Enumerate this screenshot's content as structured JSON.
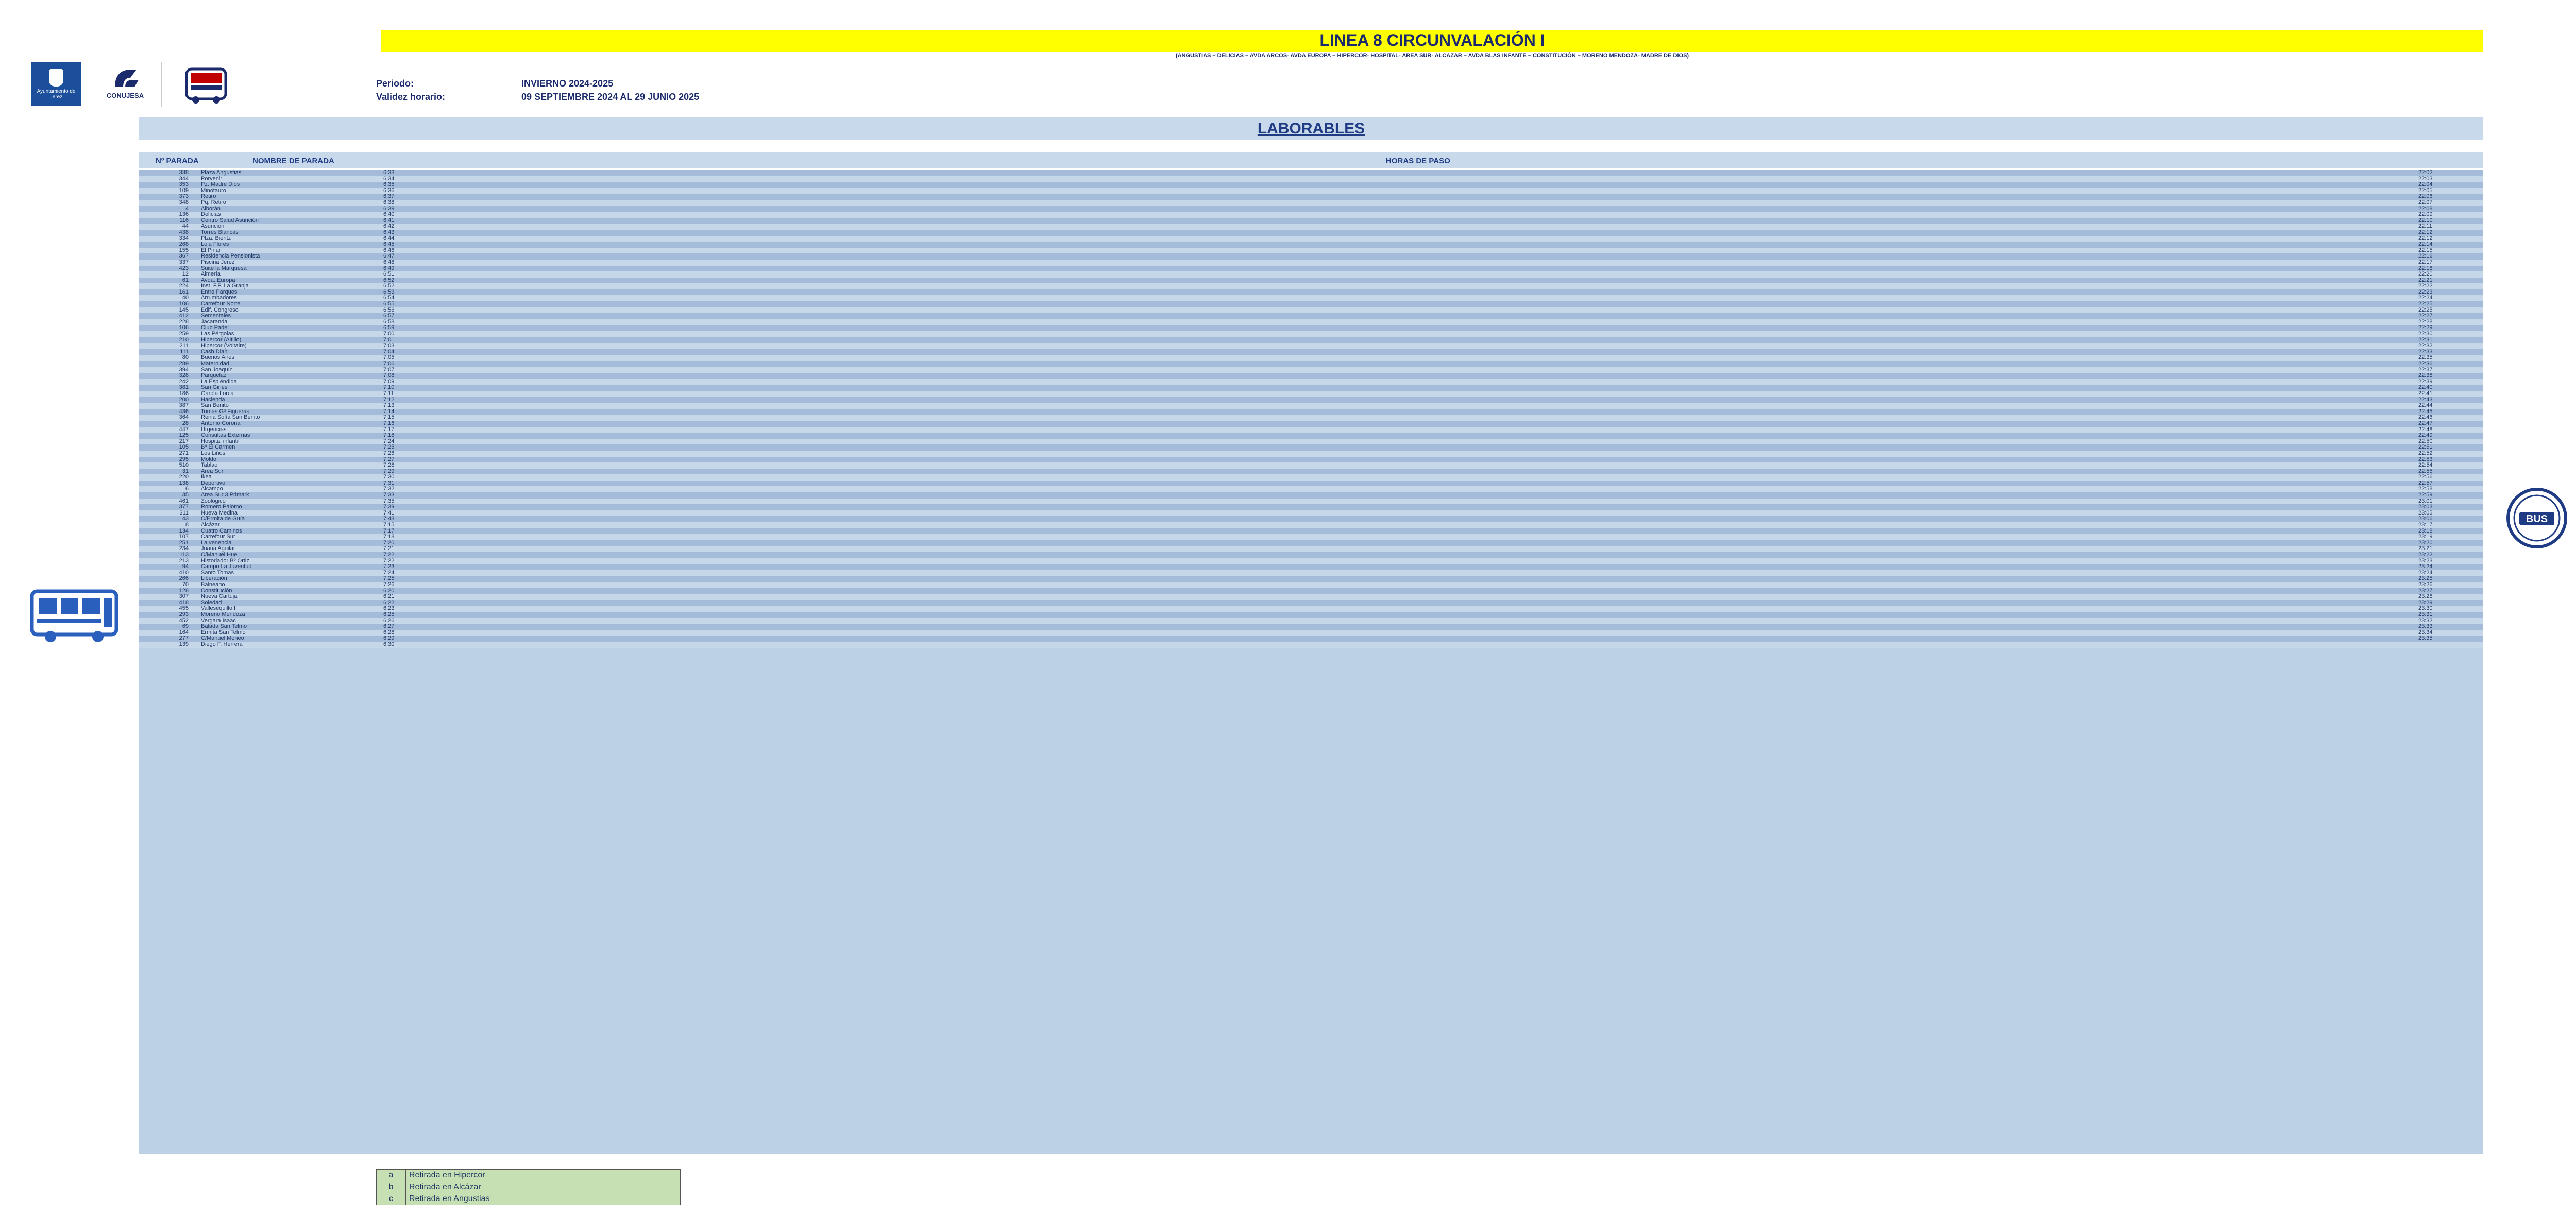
{
  "header": {
    "title": "LINEA 8 CIRCUNVALACIÓN I",
    "subtitle": "(ANGUSTIAS – DELICIAS – AVDA ARCOS- AVDA EUROPA – HIPERCOR- HOSPITAL- AREA SUR- ALCAZAR – AVDA BLAS INFANTE – CONSTITUCIÓN – MORENO MENDOZA- MADRE DE DIOS)",
    "periodo_label": "Periodo:",
    "periodo_value": "INVIERNO 2024-2025",
    "validez_label": "Validez horario:",
    "validez_value": "09 SEPTIEMBRE 2024 AL 29 JUNIO 2025",
    "logo_ayto": "Ayuntamiento de Jerez",
    "logo_conujesa": "CONUJESA"
  },
  "section_title": "LABORABLES",
  "column_headers": {
    "parada": "Nº PARADA",
    "nombre": "NOMBRE DE PARADA",
    "horas": "HORAS DE PASO"
  },
  "stops": [
    {
      "num": "338",
      "name": "Plaza Angustias",
      "first": "6:33",
      "last": "22:02"
    },
    {
      "num": "344",
      "name": "Porvenir",
      "first": "6:34",
      "last": "22:03"
    },
    {
      "num": "353",
      "name": "Pz. Madre Dios",
      "first": "6:35",
      "last": "22:04"
    },
    {
      "num": "109",
      "name": "Minotauro",
      "first": "6:36",
      "last": "22:05"
    },
    {
      "num": "373",
      "name": "Retiro",
      "first": "6:37",
      "last": "22:06"
    },
    {
      "num": "348",
      "name": "Pq. Retiro",
      "first": "6:38",
      "last": "22:07"
    },
    {
      "num": "4",
      "name": "Alborán",
      "first": "6:39",
      "last": "22:08"
    },
    {
      "num": "136",
      "name": "Delicias",
      "first": "6:40",
      "last": "22:09"
    },
    {
      "num": "116",
      "name": "Centro Salud Asunción",
      "first": "6:41",
      "last": "22:10"
    },
    {
      "num": "44",
      "name": "Asunción",
      "first": "6:42",
      "last": "22:11"
    },
    {
      "num": "438",
      "name": "Torres Blancas",
      "first": "6:43",
      "last": "22:12"
    },
    {
      "num": "334",
      "name": "Plza. Bientz",
      "first": "6:44",
      "last": "22:12"
    },
    {
      "num": "268",
      "name": "Lola Flores",
      "first": "6:45",
      "last": "22:14"
    },
    {
      "num": "155",
      "name": "El Pinar",
      "first": "6:46",
      "last": "22:15"
    },
    {
      "num": "367",
      "name": "Residencia Pensionista",
      "first": "6:47",
      "last": "22:16"
    },
    {
      "num": "337",
      "name": "Piscina Jerez",
      "first": "6:48",
      "last": "22:17"
    },
    {
      "num": "423",
      "name": "Suite la Marquesa",
      "first": "6:49",
      "last": "22:18"
    },
    {
      "num": "12",
      "name": "Almería",
      "first": "6:51",
      "last": "22:20"
    },
    {
      "num": "61",
      "name": "Avda. Europa",
      "first": "6:52",
      "last": "22:21"
    },
    {
      "num": "224",
      "name": "Inst. F.P. La Granja",
      "first": "6:52",
      "last": "22:22"
    },
    {
      "num": "161",
      "name": "Entre Parques",
      "first": "6:53",
      "last": "22:23"
    },
    {
      "num": "40",
      "name": "Arrumbadores",
      "first": "6:54",
      "last": "22:24"
    },
    {
      "num": "106",
      "name": "Carrefour Norte",
      "first": "6:55",
      "last": "22:25"
    },
    {
      "num": "145",
      "name": "Edif. Congreso",
      "first": "6:56",
      "last": "22:25"
    },
    {
      "num": "412",
      "name": "Sementales",
      "first": "6:57",
      "last": "22:27"
    },
    {
      "num": "228",
      "name": "Jacaranda",
      "first": "6:58",
      "last": "22:28"
    },
    {
      "num": "106",
      "name": "Club Padel",
      "first": "6:59",
      "last": "22:29"
    },
    {
      "num": "259",
      "name": "Las Pérgolas",
      "first": "7:00",
      "last": "22:30"
    },
    {
      "num": "210",
      "name": "Hipercor (Altillo)",
      "first": "7:01",
      "last": "22:31"
    },
    {
      "num": "211",
      "name": "Hipercor (Voltaire)",
      "first": "7:03",
      "last": "22:32"
    },
    {
      "num": "111",
      "name": "Cash Dian",
      "first": "7:04",
      "last": "22:33"
    },
    {
      "num": "80",
      "name": "Buenos Aires",
      "first": "7:05",
      "last": "22:35"
    },
    {
      "num": "289",
      "name": "Maternidad",
      "first": "7:06",
      "last": "22:36"
    },
    {
      "num": "394",
      "name": "San Joaquín",
      "first": "7:07",
      "last": "22:37"
    },
    {
      "num": "328",
      "name": "Parquelaz",
      "first": "7:08",
      "last": "22:38"
    },
    {
      "num": "242",
      "name": "La Espléndida",
      "first": "7:09",
      "last": "22:39"
    },
    {
      "num": "381",
      "name": "San Ginés",
      "first": "7:10",
      "last": "22:40"
    },
    {
      "num": "186",
      "name": "García Lorca",
      "first": "7:11",
      "last": "22:41"
    },
    {
      "num": "200",
      "name": "Hacienda",
      "first": "7:12",
      "last": "22:43"
    },
    {
      "num": "387",
      "name": "San Benito",
      "first": "7:13",
      "last": "22:44"
    },
    {
      "num": "436",
      "name": "Tomás Gª Figueras",
      "first": "7:14",
      "last": "22:45"
    },
    {
      "num": "364",
      "name": "Reina Sofía San Benito",
      "first": "7:15",
      "last": "22:46"
    },
    {
      "num": "28",
      "name": "Antonio Corona",
      "first": "7:16",
      "last": "22:47"
    },
    {
      "num": "447",
      "name": "Urgencias",
      "first": "7:17",
      "last": "22:48"
    },
    {
      "num": "125",
      "name": "Consultas Externas",
      "first": "7:18",
      "last": "22:49"
    },
    {
      "num": "217",
      "name": "Hospital infantil",
      "first": "7:24",
      "last": "22:50"
    },
    {
      "num": "105",
      "name": "Bº El Carmen",
      "first": "7:25",
      "last": "22:51"
    },
    {
      "num": "271",
      "name": "Los Liños",
      "first": "7:26",
      "last": "22:52"
    },
    {
      "num": "295",
      "name": "Moldo",
      "first": "7:27",
      "last": "22:53"
    },
    {
      "num": "510",
      "name": "Tablao",
      "first": "7:28",
      "last": "22:54"
    },
    {
      "num": "31",
      "name": "Área Sur",
      "first": "7:29",
      "last": "22:55"
    },
    {
      "num": "220",
      "name": "Ikea",
      "first": "7:30",
      "last": "22:56"
    },
    {
      "num": "138",
      "name": "Deportivo",
      "first": "7:31",
      "last": "22:57"
    },
    {
      "num": "6",
      "name": "Alcampo",
      "first": "7:32",
      "last": "22:58"
    },
    {
      "num": "35",
      "name": "Área Sur 3 Primark",
      "first": "7:33",
      "last": "22:59"
    },
    {
      "num": "461",
      "name": "Zoológico",
      "first": "7:35",
      "last": "23:01"
    },
    {
      "num": "377",
      "name": "Romero Palomo",
      "first": "7:39",
      "last": "23:03"
    },
    {
      "num": "311",
      "name": "Nueva Medina",
      "first": "7:41",
      "last": "23:05"
    },
    {
      "num": "43",
      "name": "C/Ermita de Guía",
      "first": "7:43",
      "last": "23:06"
    },
    {
      "num": "8",
      "name": "Alcázar",
      "first": "7:15",
      "last": "23:17"
    },
    {
      "num": "134",
      "name": "Cuatro Caminos",
      "first": "7:17",
      "last": "23:18"
    },
    {
      "num": "107",
      "name": "Carrefour Sur",
      "first": "7:18",
      "last": "23:19"
    },
    {
      "num": "251",
      "name": "La venencia",
      "first": "7:20",
      "last": "23:20"
    },
    {
      "num": "234",
      "name": "Juana Aguilar",
      "first": "7:21",
      "last": "23:21"
    },
    {
      "num": "113",
      "name": "C/Manuel Hue",
      "first": "7:22",
      "last": "23:22"
    },
    {
      "num": "213",
      "name": "Historiador Bº Ortiz",
      "first": "7:22",
      "last": "23:23"
    },
    {
      "num": "94",
      "name": "Campo La Juventud",
      "first": "7:23",
      "last": "23:24"
    },
    {
      "num": "410",
      "name": "Santo Tomas",
      "first": "7:24",
      "last": "23:24"
    },
    {
      "num": "266",
      "name": "Liberación",
      "first": "7:25",
      "last": "23:25"
    },
    {
      "num": "70",
      "name": "Balneario",
      "first": "7:26",
      "last": "23:26"
    },
    {
      "num": "128",
      "name": "Constitución",
      "first": "6:20",
      "last": "23:27"
    },
    {
      "num": "307",
      "name": "Nueva Cartuja",
      "first": "6:21",
      "last": "23:28"
    },
    {
      "num": "418",
      "name": "Soledad",
      "first": "6:22",
      "last": "23:29"
    },
    {
      "num": "455",
      "name": "Vallesequillo II",
      "first": "6:23",
      "last": "23:30"
    },
    {
      "num": "293",
      "name": "Moreno Mendoza",
      "first": "6:25",
      "last": "23:31"
    },
    {
      "num": "452",
      "name": "Vergara Isaac",
      "first": "6:26",
      "last": "23:32"
    },
    {
      "num": "69",
      "name": "Balada San Telmo",
      "first": "6:27",
      "last": "23:33"
    },
    {
      "num": "164",
      "name": "Ermita San Telmo",
      "first": "6:28",
      "last": "23:34"
    },
    {
      "num": "277",
      "name": "C/Manuel Moneo",
      "first": "6:29",
      "last": "23:35"
    },
    {
      "num": "139",
      "name": "Diego F. Herrera",
      "first": "6:30",
      "last": ""
    }
  ],
  "legend": [
    {
      "key": "a",
      "label": "Retirada en Hipercor"
    },
    {
      "key": "b",
      "label": "Retirada en Alcázar"
    },
    {
      "key": "c",
      "label": "Retirada en Angustias"
    }
  ],
  "colors": {
    "title_bg": "#ffff00",
    "band_bg": "#c9d9ec",
    "row_odd": "#a4bcd9",
    "row_even": "#c7d7ea",
    "legend_bg": "#c6e0b4",
    "text": "#1f3864"
  }
}
